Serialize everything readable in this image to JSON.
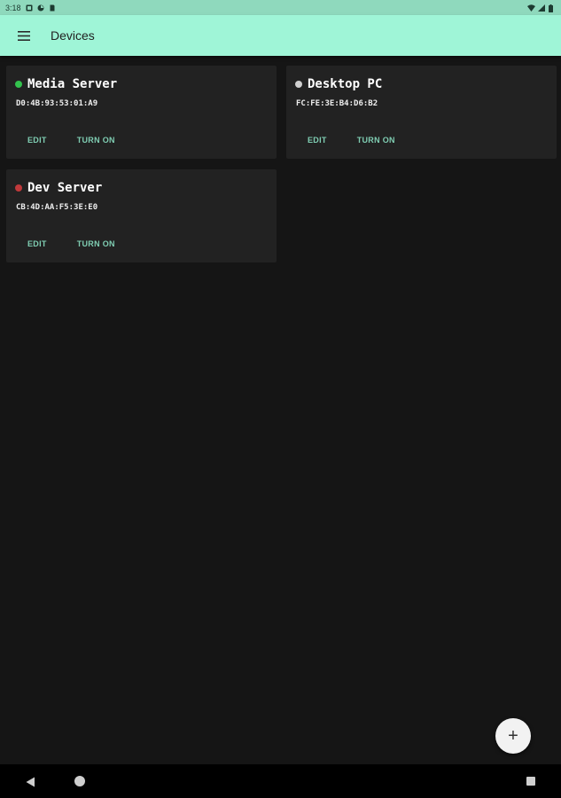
{
  "status_bar": {
    "time": "3:18",
    "icons": [
      "notification-icon",
      "sync-icon",
      "sim-icon"
    ],
    "right_icons": [
      "wifi-icon",
      "signal-icon",
      "battery-icon"
    ]
  },
  "app_bar": {
    "title": "Devices",
    "menu_icon": "hamburger-menu-icon"
  },
  "devices": [
    {
      "name": "Media Server",
      "mac": "D0:4B:93:53:01:A9",
      "status_color": "#33c24d",
      "edit_label": "EDIT",
      "power_label": "TURN ON"
    },
    {
      "name": "Desktop PC",
      "mac": "FC:FE:3E:B4:D6:B2",
      "status_color": "#cfcfcf",
      "edit_label": "EDIT",
      "power_label": "TURN ON"
    },
    {
      "name": "Dev Server",
      "mac": "CB:4D:AA:F5:3E:E0",
      "status_color": "#c0393b",
      "edit_label": "EDIT",
      "power_label": "TURN ON"
    }
  ],
  "fab": {
    "label": "+",
    "icon": "add-icon"
  },
  "nav_bar": {
    "back": "back-icon",
    "home": "home-icon",
    "recents": "recents-icon"
  },
  "colors": {
    "status_bar": "#8fd9bd",
    "app_bar": "#9ff5d7",
    "background": "#151515",
    "card": "#222222",
    "action_text": "#7fcdb2"
  }
}
